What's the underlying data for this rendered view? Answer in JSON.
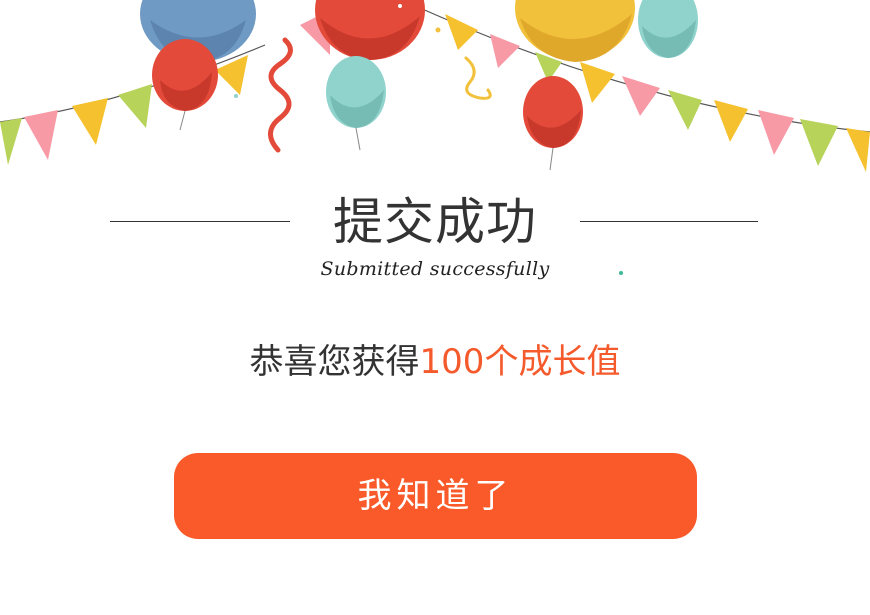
{
  "header": {
    "title": "提交成功",
    "subtitle": "Submitted successfully"
  },
  "reward": {
    "prefix": "恭喜您获得",
    "highlight": "100个成长值"
  },
  "actions": {
    "confirm_label": "我知道了"
  },
  "colors": {
    "accent": "#fa5a29",
    "highlight_text": "#f55a2c",
    "title_text": "#333333",
    "balloon_blue": "#6f9ac4",
    "balloon_red": "#e44a3a",
    "balloon_teal": "#8fd3cc",
    "balloon_yellow": "#f2c13c",
    "flag_yellow": "#f6c12f",
    "flag_pink": "#f79aa6",
    "flag_green": "#b7d35a"
  },
  "decorations": {
    "icons": [
      "balloon-icon",
      "pennant-flag-icon",
      "streamer-icon"
    ]
  }
}
